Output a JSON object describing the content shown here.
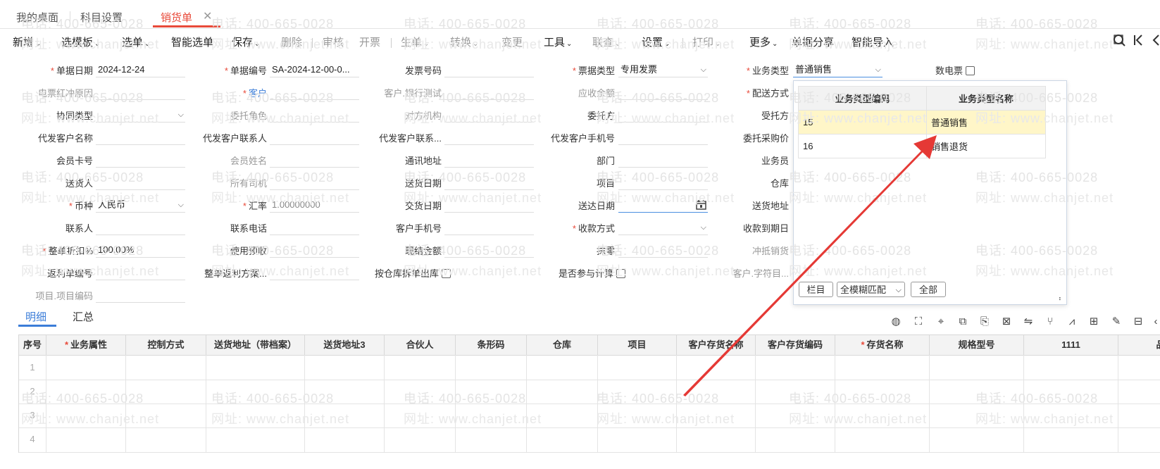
{
  "tabs": [
    {
      "label": "我的桌面"
    },
    {
      "label": "科目设置"
    },
    {
      "label": "销货单"
    }
  ],
  "tab_close": "✕",
  "toolbar": {
    "items": [
      {
        "label": "新增",
        "caret": "⌄"
      },
      {
        "label": "选模板",
        "caret": "⌄"
      },
      {
        "label": "选单",
        "caret": "⌄"
      },
      {
        "label": "智能选单"
      },
      {
        "label": "保存",
        "caret": "⌄"
      },
      {
        "label": "删除"
      },
      {
        "label": "审核"
      },
      {
        "label": "开票"
      },
      {
        "label": "生单",
        "caret": "⌄"
      },
      {
        "label": "转换",
        "caret": "⌄"
      },
      {
        "label": "变更"
      },
      {
        "label": "工具",
        "caret": "⌄"
      },
      {
        "label": "联查",
        "caret": "⌄"
      },
      {
        "label": "设置",
        "caret": "⌄"
      },
      {
        "label": "打印",
        "caret": "⌄"
      },
      {
        "label": "更多",
        "caret": "⌄"
      },
      {
        "label": "单据分享"
      },
      {
        "label": "智能导入"
      }
    ]
  },
  "form": {
    "date_label": "单据日期",
    "date_value": "2024-12-24",
    "code_label": "单据编号",
    "code_value": "SA-2024-12-00-0...",
    "invoice_no_label": "发票号码",
    "bill_type_label": "票据类型",
    "bill_type_value": "专用发票",
    "biz_type_label": "业务类型",
    "biz_type_value": "普通销售",
    "e_invoice_label": "数电票",
    "red_reason_label": "电票红冲原因",
    "customer_label": "客户",
    "customer_bank_label": "客户.银行测试",
    "receivable_label": "应收余额",
    "delivery_mode_label": "配送方式",
    "collab_type_label": "协同类型",
    "entrust_role_label": "委托角色",
    "counter_org_label": "对方机构",
    "entrustor_label": "委托方",
    "trustee_label": "受托方",
    "proxy_customer_label": "代发客户名称",
    "proxy_contact_label": "代发客户联系人",
    "proxy_contact2_label": "代发客户联系...",
    "proxy_phone_label": "代发客户手机号",
    "entrust_price_label": "委托采购价",
    "member_card_label": "会员卡号",
    "member_name_label": "会员姓名",
    "address_label": "通讯地址",
    "dept_label": "部门",
    "salesman_label": "业务员",
    "deliverer_label": "送货人",
    "driver_label": "所有司机",
    "delivery_date_label": "送货日期",
    "project_label": "项目",
    "warehouse_label": "仓库",
    "currency_label": "币种",
    "currency_value": "人民币",
    "rate_label": "汇率",
    "rate_value": "1.00000000",
    "trade_date_label": "交货日期",
    "arrive_date_label": "送达日期",
    "delivery_addr_label": "送货地址",
    "contact_label": "联系人",
    "phone_label": "联系电话",
    "customer_mobile_label": "客户手机号",
    "payment_label": "收款方式",
    "due_date_label": "收款到期日",
    "discount_label": "整单折扣%",
    "discount_value": "100.00%",
    "prepay_label": "使用预收",
    "cash_label": "现结金额",
    "writeoff_label": "抹零",
    "offset_label": "冲抵销货",
    "rebate_no_label": "返利单编号",
    "rebate_plan_label": "整单返利方案...",
    "split_label": "按仓库拆单出库",
    "calc_label": "是否参与计算",
    "customer_char_label": "客户.字符目...",
    "project_code_label": "项目.项目编码"
  },
  "popup": {
    "col1": "业务类型编码",
    "col2": "业务类型名称",
    "rows": [
      {
        "code": "15",
        "name": "普通销售"
      },
      {
        "code": "16",
        "name": "销售退货"
      }
    ],
    "btn_columns": "栏目",
    "match_value": "全模糊匹配",
    "btn_all": "全部",
    "grip": "⠆"
  },
  "subtabs": [
    {
      "label": "明细"
    },
    {
      "label": "汇总"
    }
  ],
  "grid": {
    "headers": [
      "序号",
      "业务属性",
      "控制方式",
      "送货地址（带档案）",
      "送货地址3",
      "合伙人",
      "条形码",
      "仓库",
      "项目",
      "客户存货名称",
      "客户存货编码",
      "存货名称",
      "规格型号",
      "1111",
      "品牌"
    ],
    "required_headers": [
      "业务属性",
      "存货名称"
    ],
    "row_numbers": [
      "1",
      "2",
      "3",
      "4"
    ]
  },
  "watermark": {
    "phone": "电话: 400-665-0028",
    "site": "网址: www.chanjet.net"
  },
  "colors": {
    "accent_red": "#e84a3a",
    "accent_blue": "#3b7dd8",
    "selected_row": "#fff6c8",
    "arrow": "#e53935"
  }
}
